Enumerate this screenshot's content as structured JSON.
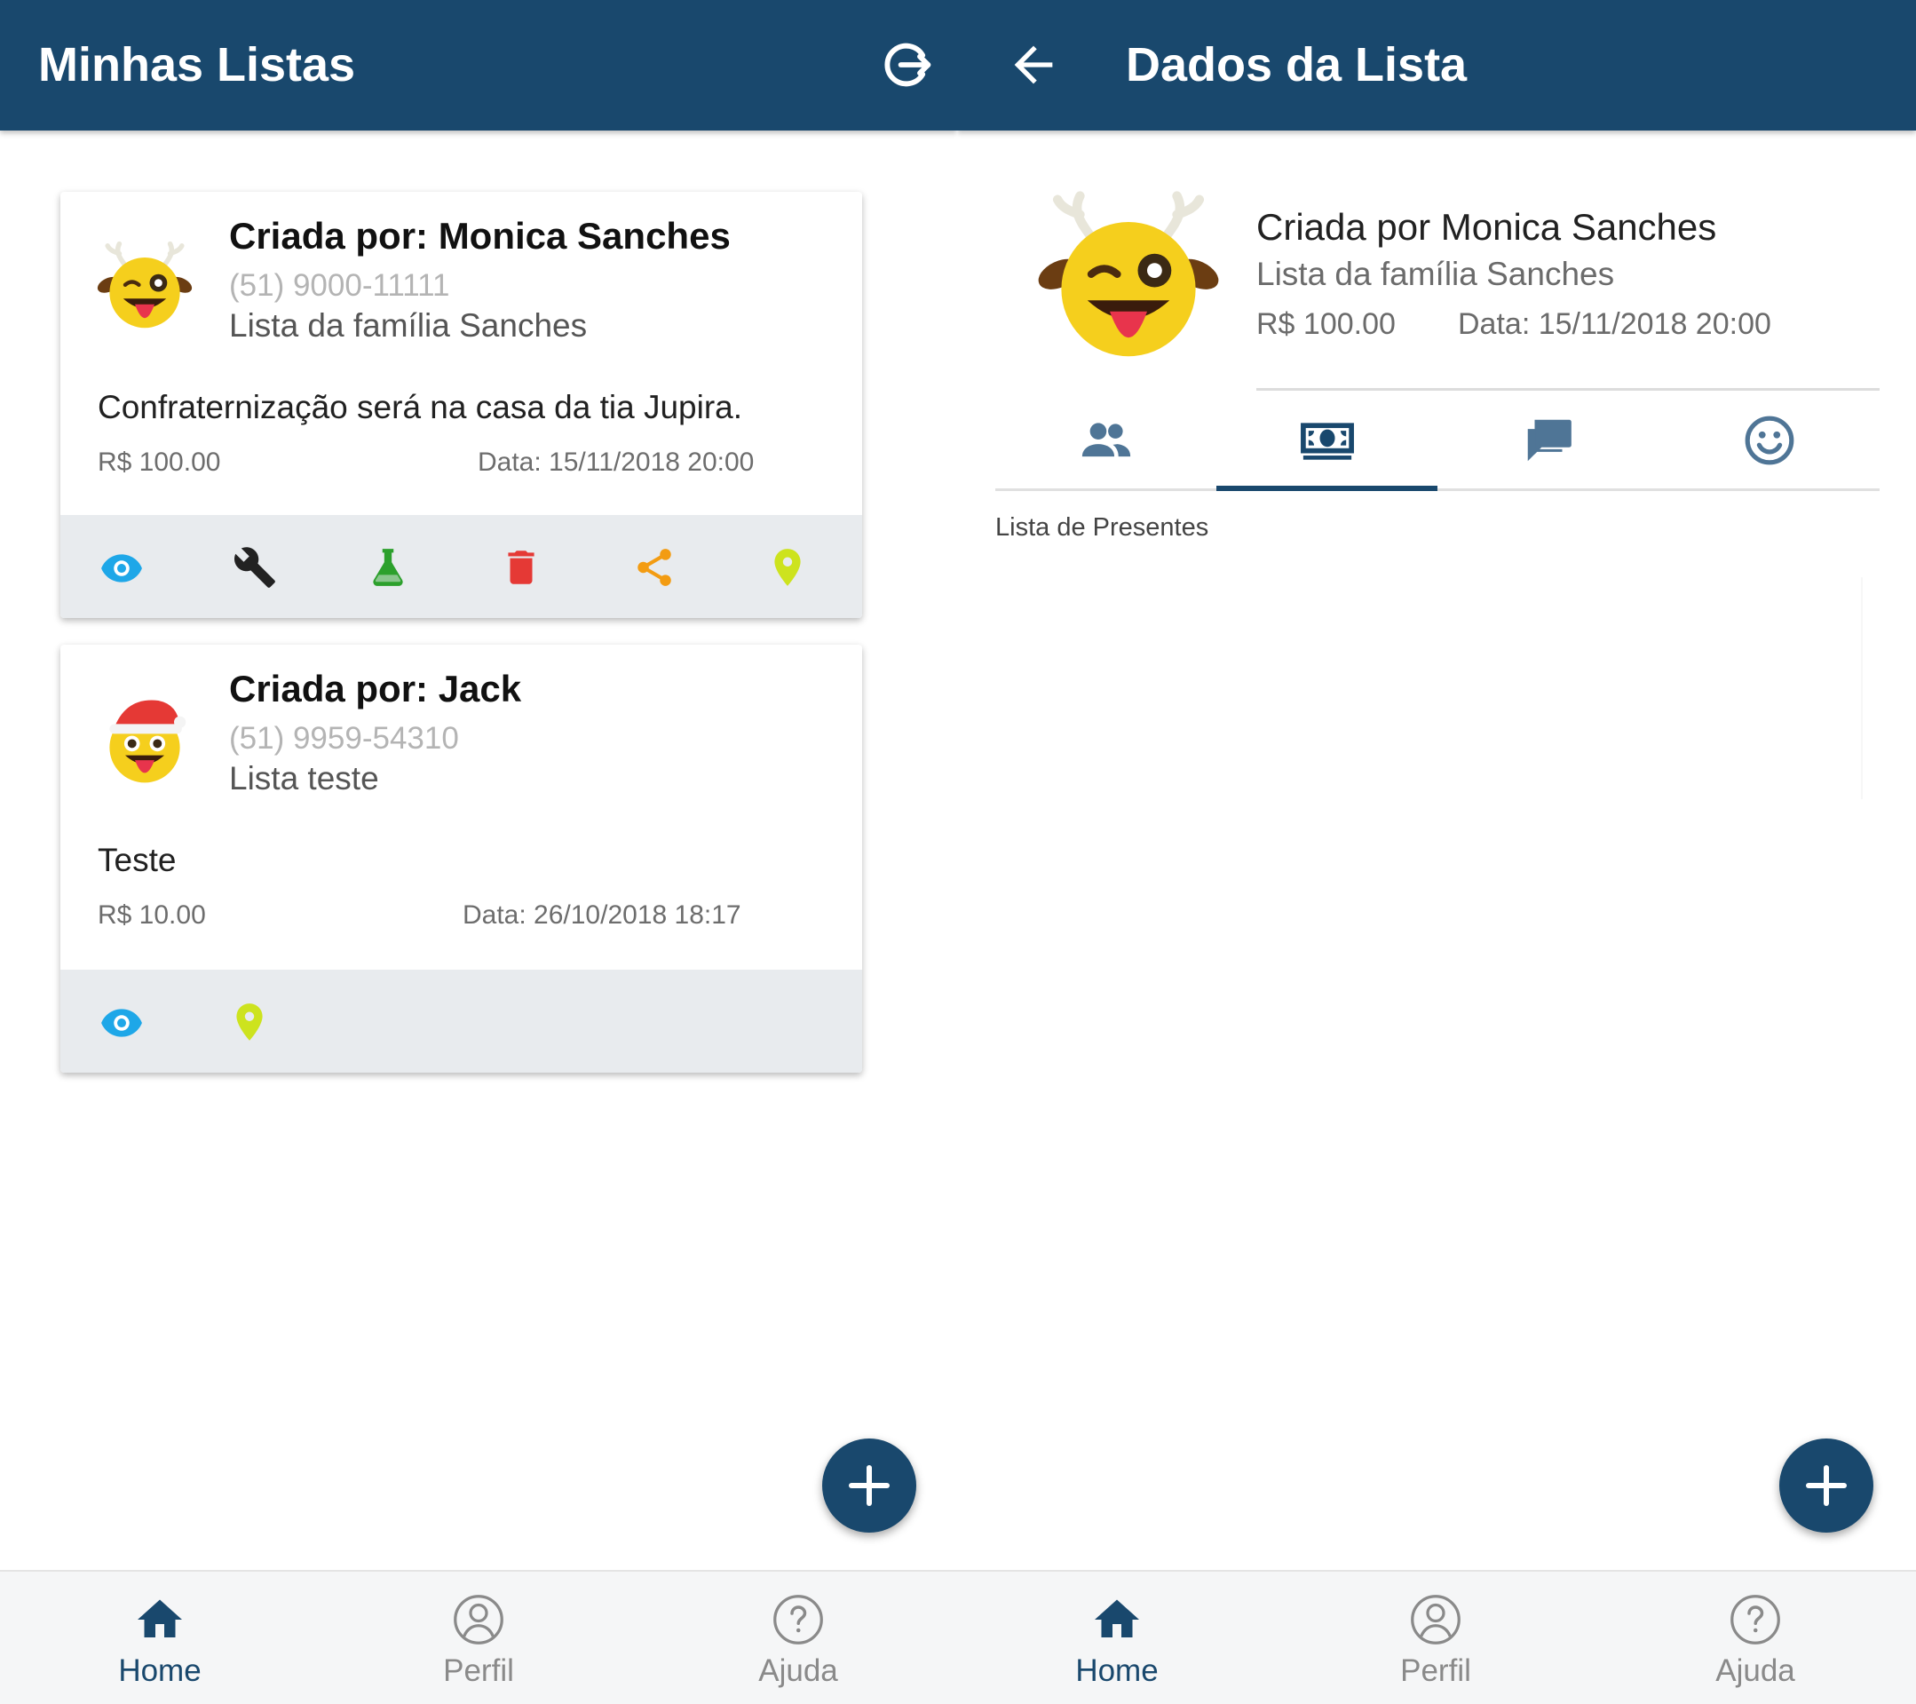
{
  "left": {
    "appbar": {
      "title": "Minhas Listas",
      "logout_icon": "logout-icon"
    },
    "cards": [
      {
        "avatar_icon": "reindeer-emoji-icon",
        "title": "Criada por: Monica Sanches",
        "phone": "(51) 9000-11111",
        "list_name": "Lista da família Sanches",
        "description": "Confraternização será na casa da tia Jupira.",
        "price": "R$ 100.00",
        "date": "Data: 15/11/2018 20:00",
        "actions": [
          "eye-icon",
          "wrench-icon",
          "flask-icon",
          "trash-icon",
          "share-icon",
          "map-pin-icon"
        ]
      },
      {
        "avatar_icon": "santa-emoji-icon",
        "title": "Criada por: Jack",
        "phone": "(51) 9959-54310",
        "list_name": "Lista teste",
        "description": "Teste",
        "price": "R$ 10.00",
        "date": "Data: 26/10/2018 18:17",
        "actions": [
          "eye-icon",
          "map-pin-icon"
        ]
      }
    ],
    "fab_icon": "plus-icon"
  },
  "right": {
    "appbar": {
      "title": "Dados da Lista",
      "back_icon": "arrow-back-icon"
    },
    "detail": {
      "avatar_icon": "reindeer-emoji-icon",
      "creator": "Criada por Monica Sanches",
      "list_name": "Lista da família Sanches",
      "price": "R$ 100.00",
      "date": "Data: 15/11/2018 20:00"
    },
    "tabs": [
      {
        "icon": "people-icon",
        "active": false
      },
      {
        "icon": "money-icon",
        "active": true
      },
      {
        "icon": "chat-icon",
        "active": false
      },
      {
        "icon": "smiley-icon",
        "active": false
      }
    ],
    "section_label": "Lista de Presentes",
    "fab_icon": "plus-icon"
  },
  "bottom_nav": [
    {
      "label": "Home",
      "icon": "home-icon",
      "active": true
    },
    {
      "label": "Perfil",
      "icon": "person-circle-icon",
      "active": false
    },
    {
      "label": "Ajuda",
      "icon": "help-circle-icon",
      "active": false
    }
  ],
  "colors": {
    "primary": "#19486d",
    "eye": "#1ea7e8",
    "wrench": "#222222",
    "flask": "#2ca02c",
    "trash": "#e53935",
    "share": "#f39c12",
    "pin": "#cde31e",
    "tab_icon": "#4f7596"
  }
}
